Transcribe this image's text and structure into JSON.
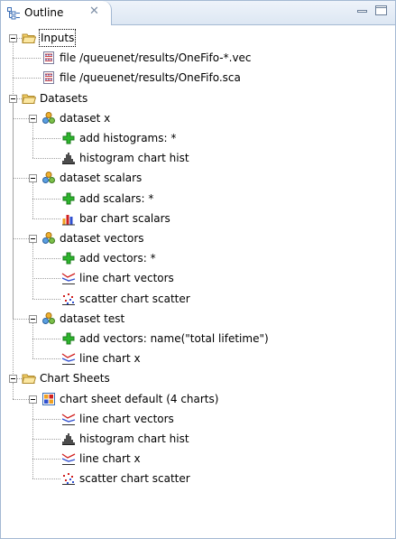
{
  "panel": {
    "title": "Outline"
  },
  "tree": {
    "inputs": {
      "label": "Inputs",
      "files": [
        "file /queuenet/results/OneFifo-*.vec",
        "file /queuenet/results/OneFifo.sca"
      ]
    },
    "datasets": {
      "label": "Datasets",
      "items": [
        {
          "label": "dataset x",
          "children": [
            "add histograms: *",
            "histogram chart hist"
          ]
        },
        {
          "label": "dataset scalars",
          "children": [
            "add scalars: *",
            "bar chart scalars"
          ]
        },
        {
          "label": "dataset vectors",
          "children": [
            "add vectors: *",
            "line chart vectors",
            "scatter chart scatter"
          ]
        },
        {
          "label": "dataset test",
          "children": [
            "add vectors: name(\"total lifetime\")",
            "line chart x"
          ]
        }
      ]
    },
    "chart_sheets": {
      "label": "Chart Sheets",
      "sheet": {
        "label": "chart sheet default (4 charts)",
        "children": [
          "line chart vectors",
          "histogram chart hist",
          "line chart x",
          "scatter chart scatter"
        ]
      }
    }
  },
  "icons": {
    "folder": "folder-open-icon",
    "file": "result-file-icon",
    "dataset": "dataset-icon",
    "add": "add-icon",
    "histogram": "histogram-chart-icon",
    "bar": "bar-chart-icon",
    "line": "line-chart-icon",
    "scatter": "scatter-chart-icon",
    "sheet": "chart-sheet-icon"
  },
  "colors": {
    "border": "#a4b9d3",
    "add_green": "#2db52d",
    "folder_yellow": "#f6d36b"
  }
}
